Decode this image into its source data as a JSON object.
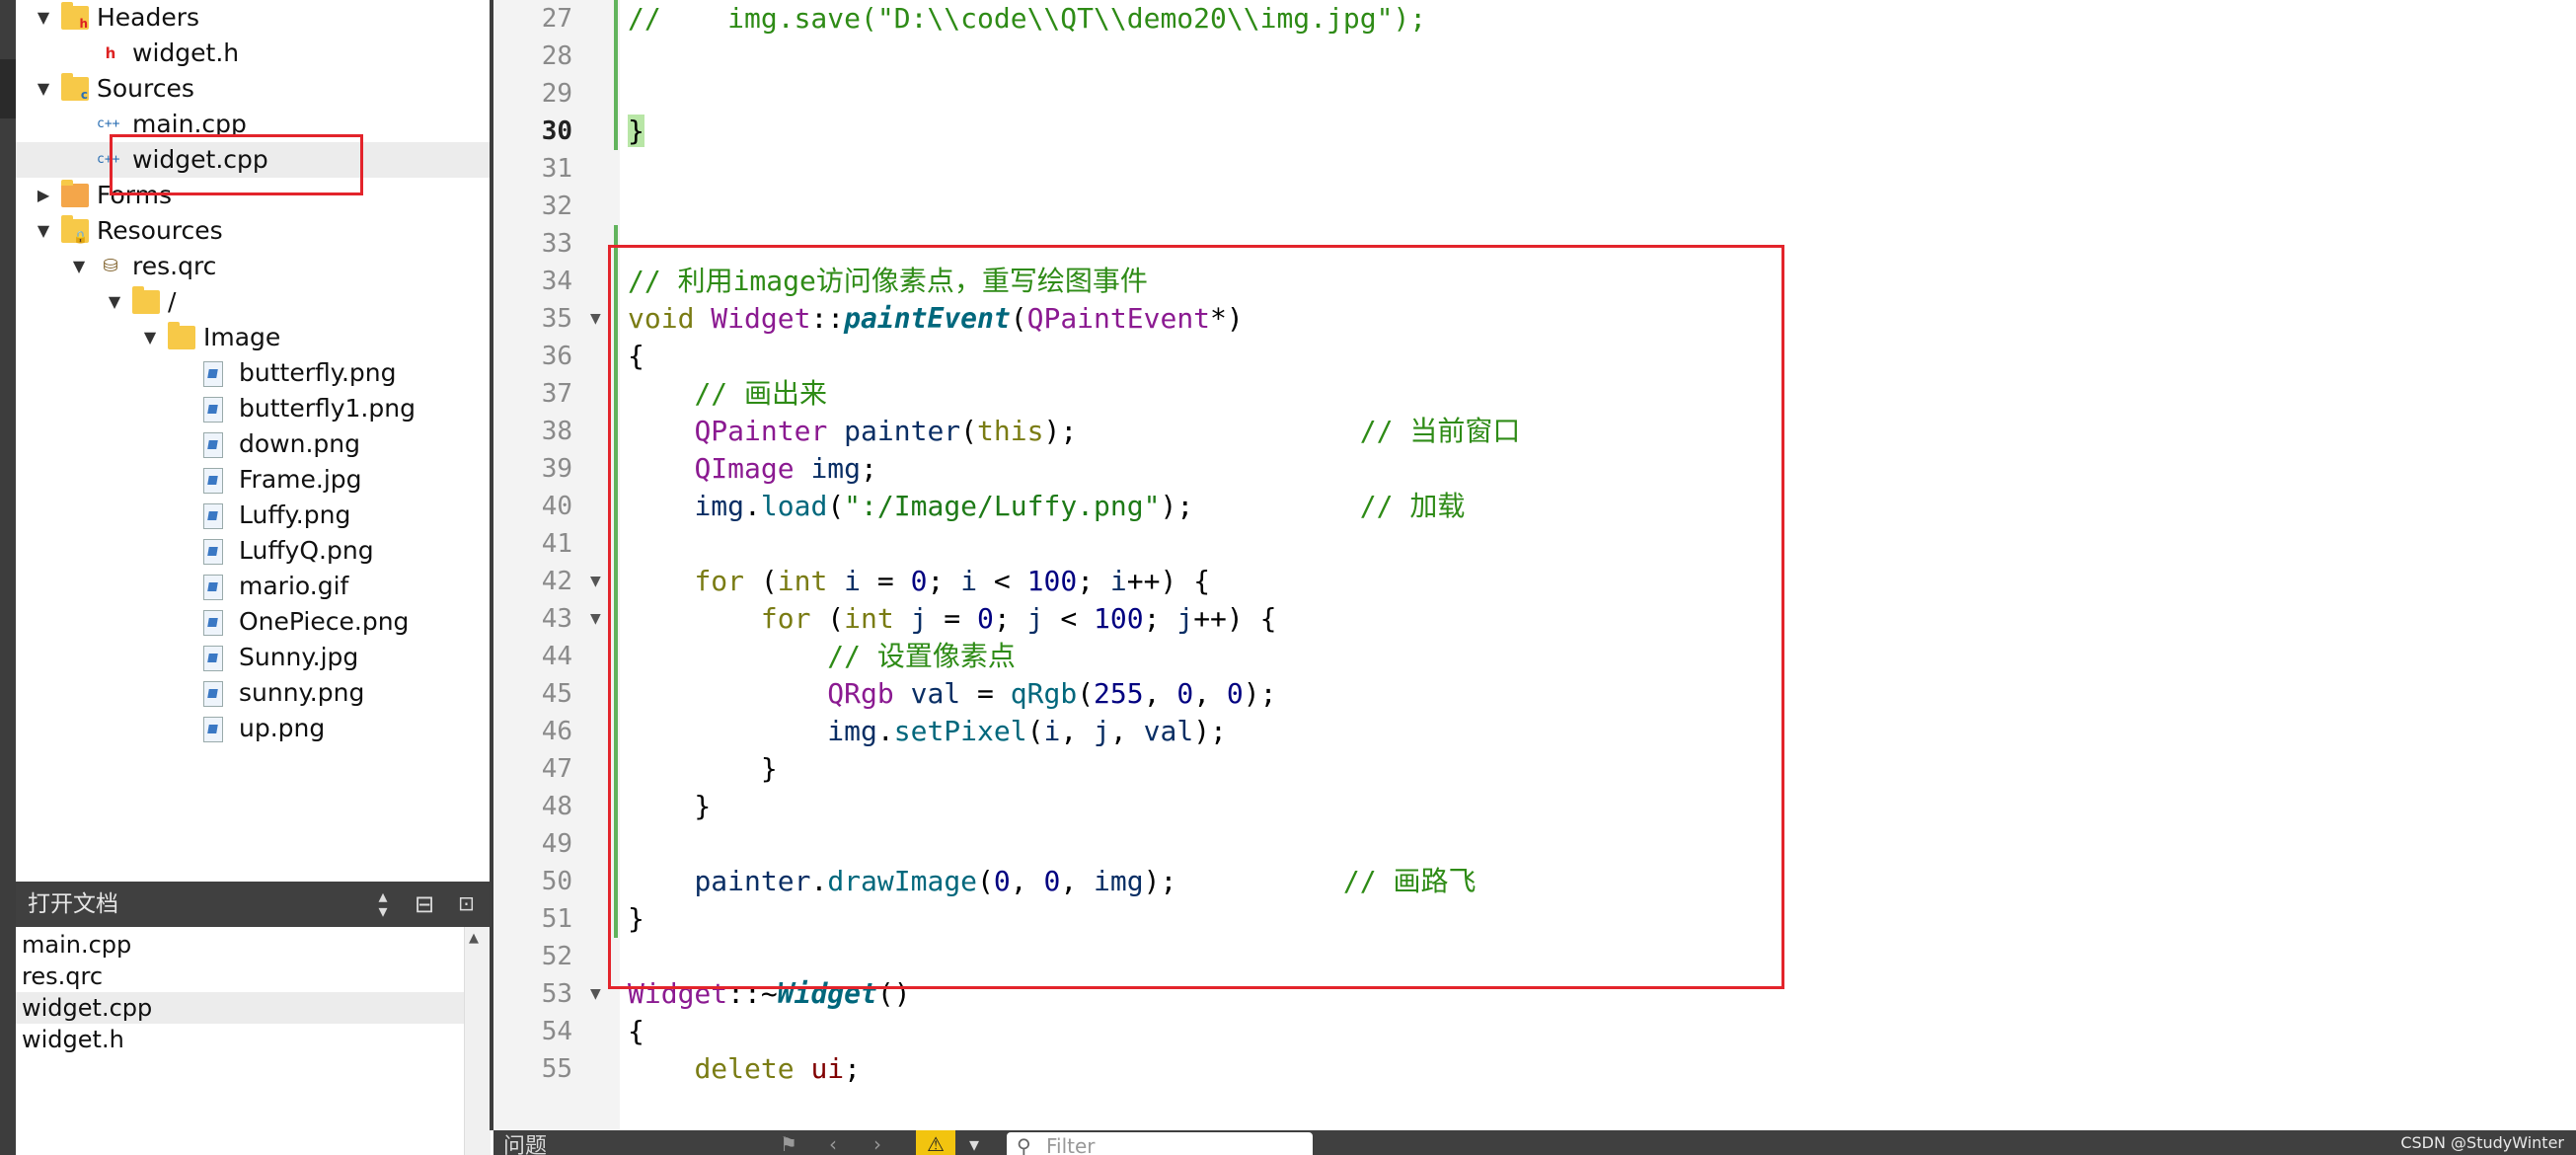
{
  "project_tree": [
    {
      "label": "Headers",
      "icon": "headers-folder-icon",
      "arrow": "expanded",
      "depth": 1
    },
    {
      "label": "widget.h",
      "icon": "header-file-icon",
      "arrow": "none",
      "depth": 2
    },
    {
      "label": "Sources",
      "icon": "sources-folder-icon",
      "arrow": "expanded",
      "depth": 1
    },
    {
      "label": "main.cpp",
      "icon": "cpp-file-icon",
      "arrow": "none",
      "depth": 2
    },
    {
      "label": "widget.cpp",
      "icon": "cpp-file-icon",
      "arrow": "none",
      "depth": 2,
      "selected": true
    },
    {
      "label": "Forms",
      "icon": "forms-folder-icon",
      "arrow": "collapsed",
      "depth": 1
    },
    {
      "label": "Resources",
      "icon": "resources-folder-icon",
      "arrow": "expanded",
      "depth": 1
    },
    {
      "label": "res.qrc",
      "icon": "qrc-file-icon",
      "arrow": "expanded",
      "depth": 2
    },
    {
      "label": "/",
      "icon": "folder-icon",
      "arrow": "expanded",
      "depth": 3
    },
    {
      "label": "Image",
      "icon": "folder-icon",
      "arrow": "expanded",
      "depth": 4
    },
    {
      "label": "butterfly.png",
      "icon": "image-file-icon",
      "arrow": "none",
      "depth": 5
    },
    {
      "label": "butterfly1.png",
      "icon": "image-file-icon",
      "arrow": "none",
      "depth": 5
    },
    {
      "label": "down.png",
      "icon": "image-file-icon",
      "arrow": "none",
      "depth": 5
    },
    {
      "label": "Frame.jpg",
      "icon": "image-file-icon",
      "arrow": "none",
      "depth": 5
    },
    {
      "label": "Luffy.png",
      "icon": "image-file-icon",
      "arrow": "none",
      "depth": 5
    },
    {
      "label": "LuffyQ.png",
      "icon": "image-file-icon",
      "arrow": "none",
      "depth": 5
    },
    {
      "label": "mario.gif",
      "icon": "image-file-icon",
      "arrow": "none",
      "depth": 5
    },
    {
      "label": "OnePiece.png",
      "icon": "image-file-icon",
      "arrow": "none",
      "depth": 5
    },
    {
      "label": "Sunny.jpg",
      "icon": "image-file-icon",
      "arrow": "none",
      "depth": 5
    },
    {
      "label": "sunny.png",
      "icon": "image-file-icon",
      "arrow": "none",
      "depth": 5
    },
    {
      "label": "up.png",
      "icon": "image-file-icon",
      "arrow": "none",
      "depth": 5
    }
  ],
  "open_documents": {
    "title": "打开文档",
    "items": [
      "main.cpp",
      "res.qrc",
      "widget.cpp",
      "widget.h"
    ],
    "selected": "widget.cpp"
  },
  "editor": {
    "current_line": 30,
    "lines": [
      {
        "n": 27,
        "fold": false,
        "modified": true,
        "tokens": [
          [
            "com",
            "//    img.save(\"D:\\\\code\\\\QT\\\\demo20\\\\img.jpg\");"
          ]
        ]
      },
      {
        "n": 28,
        "fold": false,
        "modified": true,
        "tokens": []
      },
      {
        "n": 29,
        "fold": false,
        "modified": true,
        "tokens": []
      },
      {
        "n": 30,
        "fold": false,
        "modified": true,
        "tokens": [
          [
            "hl",
            "}"
          ]
        ]
      },
      {
        "n": 31,
        "fold": false,
        "modified": false,
        "tokens": []
      },
      {
        "n": 32,
        "fold": false,
        "modified": false,
        "tokens": []
      },
      {
        "n": 33,
        "fold": false,
        "modified": true,
        "tokens": []
      },
      {
        "n": 34,
        "fold": false,
        "modified": true,
        "tokens": [
          [
            "com",
            "// 利用image访问像素点，重写绘图事件"
          ]
        ]
      },
      {
        "n": 35,
        "fold": true,
        "modified": true,
        "tokens": [
          [
            "kw",
            "void "
          ],
          [
            "type",
            "Widget"
          ],
          [
            "plain",
            "::"
          ],
          [
            "fni",
            "paintEvent"
          ],
          [
            "plain",
            "("
          ],
          [
            "type",
            "QPaintEvent"
          ],
          [
            "plain",
            "*)"
          ]
        ]
      },
      {
        "n": 36,
        "fold": false,
        "modified": true,
        "tokens": [
          [
            "plain",
            "{"
          ]
        ]
      },
      {
        "n": 37,
        "fold": false,
        "modified": true,
        "tokens": [
          [
            "plain",
            "    "
          ],
          [
            "com",
            "// 画出来"
          ]
        ]
      },
      {
        "n": 38,
        "fold": false,
        "modified": true,
        "tokens": [
          [
            "plain",
            "    "
          ],
          [
            "type",
            "QPainter "
          ],
          [
            "var",
            "painter"
          ],
          [
            "plain",
            "("
          ],
          [
            "kw",
            "this"
          ],
          [
            "plain",
            ");                 "
          ],
          [
            "com",
            "// 当前窗口"
          ]
        ]
      },
      {
        "n": 39,
        "fold": false,
        "modified": true,
        "tokens": [
          [
            "plain",
            "    "
          ],
          [
            "type",
            "QImage "
          ],
          [
            "var",
            "img"
          ],
          [
            "plain",
            ";"
          ]
        ]
      },
      {
        "n": 40,
        "fold": false,
        "modified": true,
        "tokens": [
          [
            "plain",
            "    "
          ],
          [
            "var",
            "img"
          ],
          [
            "plain",
            "."
          ],
          [
            "fn",
            "load"
          ],
          [
            "plain",
            "("
          ],
          [
            "str",
            "\":/Image/Luffy.png\""
          ],
          [
            "plain",
            ");          "
          ],
          [
            "com",
            "// 加载"
          ]
        ]
      },
      {
        "n": 41,
        "fold": false,
        "modified": true,
        "tokens": []
      },
      {
        "n": 42,
        "fold": true,
        "modified": true,
        "tokens": [
          [
            "plain",
            "    "
          ],
          [
            "kw",
            "for "
          ],
          [
            "plain",
            "("
          ],
          [
            "kw",
            "int "
          ],
          [
            "var",
            "i"
          ],
          [
            "plain",
            " = "
          ],
          [
            "num",
            "0"
          ],
          [
            "plain",
            "; "
          ],
          [
            "var",
            "i"
          ],
          [
            "plain",
            " < "
          ],
          [
            "num",
            "100"
          ],
          [
            "plain",
            "; "
          ],
          [
            "var",
            "i"
          ],
          [
            "plain",
            "++) {"
          ]
        ]
      },
      {
        "n": 43,
        "fold": true,
        "modified": true,
        "tokens": [
          [
            "plain",
            "        "
          ],
          [
            "kw",
            "for "
          ],
          [
            "plain",
            "("
          ],
          [
            "kw",
            "int "
          ],
          [
            "var",
            "j"
          ],
          [
            "plain",
            " = "
          ],
          [
            "num",
            "0"
          ],
          [
            "plain",
            "; "
          ],
          [
            "var",
            "j"
          ],
          [
            "plain",
            " < "
          ],
          [
            "num",
            "100"
          ],
          [
            "plain",
            "; "
          ],
          [
            "var",
            "j"
          ],
          [
            "plain",
            "++) {"
          ]
        ]
      },
      {
        "n": 44,
        "fold": false,
        "modified": true,
        "tokens": [
          [
            "plain",
            "            "
          ],
          [
            "com",
            "// 设置像素点"
          ]
        ]
      },
      {
        "n": 45,
        "fold": false,
        "modified": true,
        "tokens": [
          [
            "plain",
            "            "
          ],
          [
            "type",
            "QRgb "
          ],
          [
            "var",
            "val"
          ],
          [
            "plain",
            " = "
          ],
          [
            "fn",
            "qRgb"
          ],
          [
            "plain",
            "("
          ],
          [
            "num",
            "255"
          ],
          [
            "plain",
            ", "
          ],
          [
            "num",
            "0"
          ],
          [
            "plain",
            ", "
          ],
          [
            "num",
            "0"
          ],
          [
            "plain",
            ");"
          ]
        ]
      },
      {
        "n": 46,
        "fold": false,
        "modified": true,
        "tokens": [
          [
            "plain",
            "            "
          ],
          [
            "var",
            "img"
          ],
          [
            "plain",
            "."
          ],
          [
            "fn",
            "setPixel"
          ],
          [
            "plain",
            "("
          ],
          [
            "var",
            "i"
          ],
          [
            "plain",
            ", "
          ],
          [
            "var",
            "j"
          ],
          [
            "plain",
            ", "
          ],
          [
            "var",
            "val"
          ],
          [
            "plain",
            ");"
          ]
        ]
      },
      {
        "n": 47,
        "fold": false,
        "modified": true,
        "tokens": [
          [
            "plain",
            "        }"
          ]
        ]
      },
      {
        "n": 48,
        "fold": false,
        "modified": true,
        "tokens": [
          [
            "plain",
            "    }"
          ]
        ]
      },
      {
        "n": 49,
        "fold": false,
        "modified": true,
        "tokens": []
      },
      {
        "n": 50,
        "fold": false,
        "modified": true,
        "tokens": [
          [
            "plain",
            "    "
          ],
          [
            "var",
            "painter"
          ],
          [
            "plain",
            "."
          ],
          [
            "fn",
            "drawImage"
          ],
          [
            "plain",
            "("
          ],
          [
            "num",
            "0"
          ],
          [
            "plain",
            ", "
          ],
          [
            "num",
            "0"
          ],
          [
            "plain",
            ", "
          ],
          [
            "var",
            "img"
          ],
          [
            "plain",
            ");          "
          ],
          [
            "com",
            "// 画路飞"
          ]
        ]
      },
      {
        "n": 51,
        "fold": false,
        "modified": true,
        "tokens": [
          [
            "plain",
            "}"
          ]
        ]
      },
      {
        "n": 52,
        "fold": false,
        "modified": false,
        "tokens": []
      },
      {
        "n": 53,
        "fold": true,
        "modified": false,
        "tokens": [
          [
            "type",
            "Widget"
          ],
          [
            "plain",
            "::~"
          ],
          [
            "fni",
            "Widget"
          ],
          [
            "plain",
            "()"
          ]
        ]
      },
      {
        "n": 54,
        "fold": false,
        "modified": false,
        "tokens": [
          [
            "plain",
            "{"
          ]
        ]
      },
      {
        "n": 55,
        "fold": false,
        "modified": false,
        "tokens": [
          [
            "plain",
            "    "
          ],
          [
            "kw",
            "delete "
          ],
          [
            "mem",
            "ui"
          ],
          [
            "plain",
            ";"
          ]
        ]
      }
    ]
  },
  "status_bar": {
    "issues_label": "问题",
    "filter_placeholder": "Filter",
    "watermark": "CSDN @StudyWinter"
  },
  "colors": {
    "annotation_red": "#e3242b",
    "comment_green": "#2e8b16",
    "keyword_olive": "#7a7c14",
    "type_purple": "#8b1a91",
    "modified_bar_green": "#61b35c"
  }
}
